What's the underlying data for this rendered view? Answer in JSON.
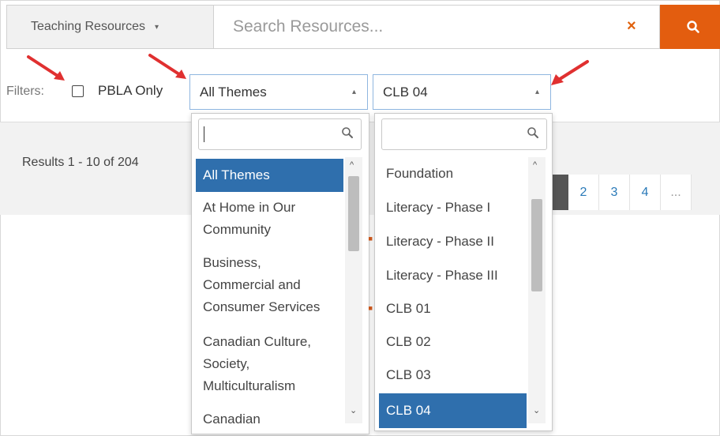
{
  "search_bar": {
    "category": "Teaching Resources",
    "category_caret": "▾",
    "placeholder": "Search Resources...",
    "clear_icon": "close-icon",
    "search_icon": "search-icon",
    "accent_color": "#e35d0f"
  },
  "filters": {
    "label": "Filters:",
    "pbla_label": "PBLA Only",
    "pbla_checked": false,
    "theme_value": "All Themes",
    "level_value": "CLB 04",
    "open_caret": "▴"
  },
  "results": {
    "text": "Results 1 - 10 of 204",
    "pages": [
      "2",
      "3",
      "4",
      "..."
    ]
  },
  "theme_dropdown": {
    "options": [
      "All Themes",
      "At Home in Our\nCommunity",
      "Business,\nCommercial and\nConsumer Services",
      "Canadian Culture,\nSociety,\nMulticulturalism",
      "Canadian"
    ],
    "selected": "All Themes"
  },
  "level_dropdown": {
    "options": [
      "Foundation",
      "Literacy - Phase I",
      "Literacy - Phase II",
      "Literacy - Phase III",
      "CLB 01",
      "CLB 02",
      "CLB 03",
      "CLB 04"
    ],
    "selected": "CLB 04"
  },
  "scroll_up": "^",
  "scroll_down": "⌄"
}
